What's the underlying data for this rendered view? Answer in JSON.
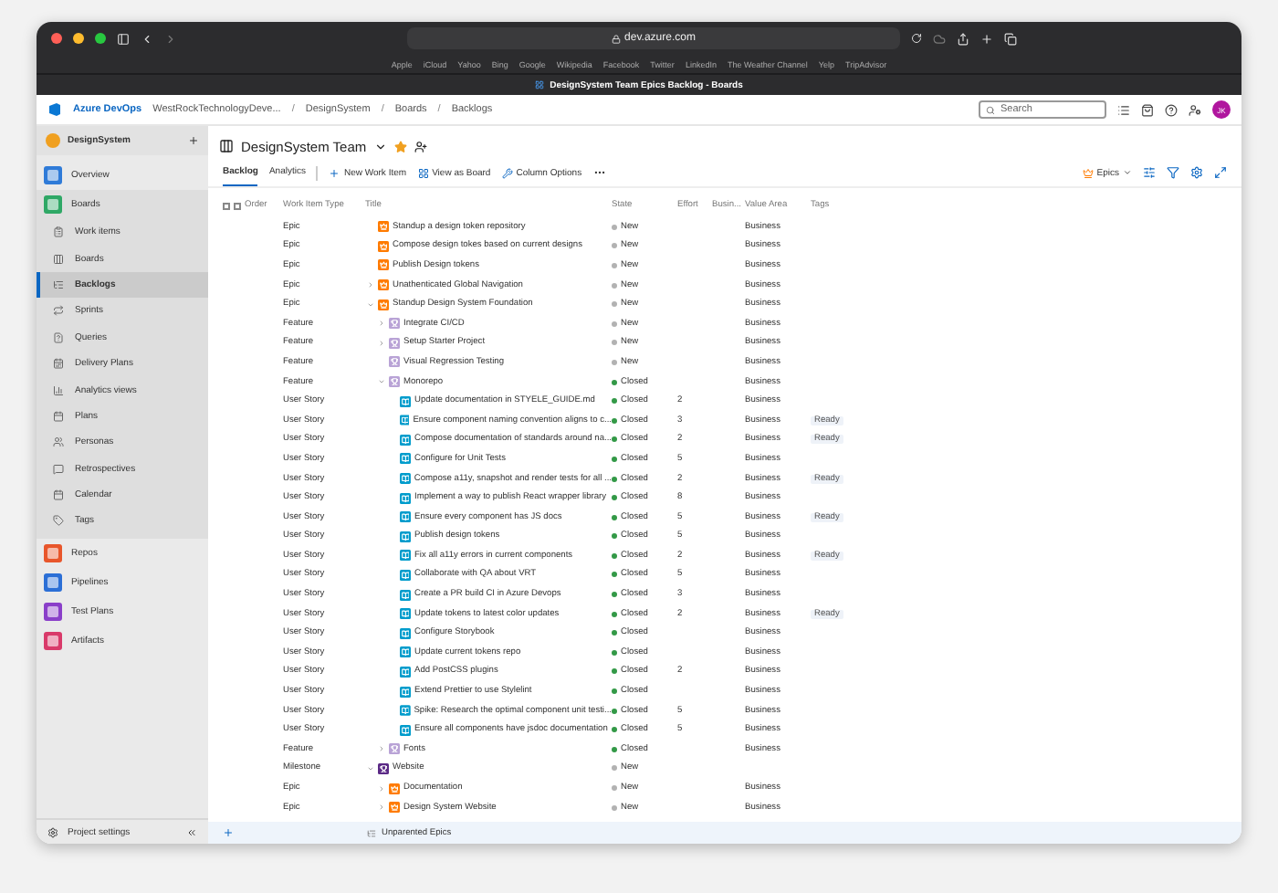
{
  "browser": {
    "address": "dev.azure.com",
    "favorites": [
      "Apple",
      "iCloud",
      "Yahoo",
      "Bing",
      "Google",
      "Wikipedia",
      "Facebook",
      "Twitter",
      "LinkedIn",
      "The Weather Channel",
      "Yelp",
      "TripAdvisor"
    ],
    "tab_title": "DesignSystem Team Epics Backlog - Boards"
  },
  "header": {
    "product": "Azure DevOps",
    "breadcrumbs": [
      {
        "label": "WestRockTechnologyDeve..."
      },
      {
        "separator": "/",
        "label": "DesignSystem"
      },
      {
        "separator": "/",
        "label": "Boards"
      },
      {
        "separator": "/",
        "label": "Backlogs"
      }
    ],
    "search": {
      "placeholder": "Search"
    },
    "avatar": "JK"
  },
  "sidebar": {
    "project": "DesignSystem",
    "items": [
      {
        "label": "Overview",
        "color": "#2f7bd8",
        "expanded": false,
        "selected": false
      },
      {
        "label": "Boards",
        "color": "#2fa866",
        "expanded": true,
        "selected": false,
        "children": [
          {
            "label": "Work items",
            "selected": false
          },
          {
            "label": "Boards",
            "selected": false
          },
          {
            "label": "Backlogs",
            "selected": true
          },
          {
            "label": "Sprints",
            "selected": false
          },
          {
            "label": "Queries",
            "selected": false
          },
          {
            "label": "Delivery Plans",
            "selected": false
          },
          {
            "label": "Analytics views",
            "selected": false
          },
          {
            "label": "Plans",
            "selected": false
          },
          {
            "label": "Personas",
            "selected": false
          },
          {
            "label": "Retrospectives",
            "selected": false
          },
          {
            "label": "Calendar",
            "selected": false
          },
          {
            "label": "Tags",
            "selected": false
          }
        ]
      },
      {
        "label": "Repos",
        "color": "#e8562b",
        "expanded": false,
        "selected": false
      },
      {
        "label": "Pipelines",
        "color": "#2b6fd6",
        "expanded": false,
        "selected": false
      },
      {
        "label": "Test Plans",
        "color": "#8a3fc9",
        "expanded": false,
        "selected": false
      },
      {
        "label": "Artifacts",
        "color": "#d93a6a",
        "expanded": false,
        "selected": false
      }
    ],
    "footer": "Project settings"
  },
  "team": {
    "name": "DesignSystem Team",
    "favorite": true
  },
  "tabs": [
    {
      "label": "Backlog",
      "selected": true
    },
    {
      "label": "Analytics",
      "selected": false
    }
  ],
  "toolbar": [
    "New Work Item",
    "View as Board",
    "Column Options"
  ],
  "level": "Epics",
  "columns": [
    "Order",
    "Work Item Type",
    "Title",
    "State",
    "Effort",
    "Busin...",
    "Value Area",
    "Tags"
  ],
  "rows": [
    {
      "type": "Epic",
      "kind": "epic",
      "title": "Standup a design token repository",
      "state": "New",
      "color": "#b2b2b2",
      "value_area": "Business"
    },
    {
      "type": "Epic",
      "kind": "epic",
      "title": "Compose design tokes based on current designs",
      "state": "New",
      "color": "#b2b2b2",
      "value_area": "Business"
    },
    {
      "type": "Epic",
      "kind": "epic",
      "title": "Publish Design tokens",
      "state": "New",
      "color": "#b2b2b2",
      "value_area": "Business"
    },
    {
      "type": "Epic",
      "kind": "epic",
      "title": "Unathenticated Global Navigation",
      "state": "New",
      "color": "#b2b2b2",
      "value_area": "Business",
      "expanded": false
    },
    {
      "type": "Epic",
      "kind": "epic",
      "title": "Standup Design System Foundation",
      "state": "New",
      "color": "#b2b2b2",
      "value_area": "Business",
      "expanded": true,
      "children": [
        {
          "type": "Feature",
          "kind": "feature",
          "title": "Integrate CI/CD",
          "state": "New",
          "color": "#b2b2b2",
          "value_area": "Business",
          "expanded": false
        },
        {
          "type": "Feature",
          "kind": "feature",
          "title": "Setup Starter Project",
          "state": "New",
          "color": "#b2b2b2",
          "value_area": "Business",
          "expanded": false
        },
        {
          "type": "Feature",
          "kind": "feature",
          "title": "Visual Regression Testing",
          "state": "New",
          "color": "#b2b2b2",
          "value_area": "Business"
        },
        {
          "type": "Feature",
          "kind": "feature",
          "title": "Monorepo",
          "state": "Closed",
          "color": "#339947",
          "value_area": "Business",
          "expanded": true,
          "children": [
            {
              "type": "User Story",
              "kind": "story",
              "title": "Update documentation in STYELE_GUIDE.md",
              "state": "Closed",
              "color": "#339947",
              "effort": "2",
              "value_area": "Business"
            },
            {
              "type": "User Story",
              "kind": "story",
              "title": "Ensure component naming convention aligns to c...",
              "state": "Closed",
              "color": "#339947",
              "effort": "3",
              "value_area": "Business",
              "tag": "Ready"
            },
            {
              "type": "User Story",
              "kind": "story",
              "title": "Compose documentation of standards around na...",
              "state": "Closed",
              "color": "#339947",
              "effort": "2",
              "value_area": "Business",
              "tag": "Ready"
            },
            {
              "type": "User Story",
              "kind": "story",
              "title": "Configure for Unit Tests",
              "state": "Closed",
              "color": "#339947",
              "effort": "5",
              "value_area": "Business"
            },
            {
              "type": "User Story",
              "kind": "story",
              "title": "Compose a11y, snapshot and render tests for all ...",
              "state": "Closed",
              "color": "#339947",
              "effort": "2",
              "value_area": "Business",
              "tag": "Ready"
            },
            {
              "type": "User Story",
              "kind": "story",
              "title": "Implement a way to publish React wrapper library",
              "state": "Closed",
              "color": "#339947",
              "effort": "8",
              "value_area": "Business"
            },
            {
              "type": "User Story",
              "kind": "story",
              "title": "Ensure every component has JS docs",
              "state": "Closed",
              "color": "#339947",
              "effort": "5",
              "value_area": "Business",
              "tag": "Ready"
            },
            {
              "type": "User Story",
              "kind": "story",
              "title": "Publish design tokens",
              "state": "Closed",
              "color": "#339947",
              "effort": "5",
              "value_area": "Business"
            },
            {
              "type": "User Story",
              "kind": "story",
              "title": "Fix all a11y errors in current components",
              "state": "Closed",
              "color": "#339947",
              "effort": "2",
              "value_area": "Business",
              "tag": "Ready"
            },
            {
              "type": "User Story",
              "kind": "story",
              "title": "Collaborate with QA about VRT",
              "state": "Closed",
              "color": "#339947",
              "effort": "5",
              "value_area": "Business"
            },
            {
              "type": "User Story",
              "kind": "story",
              "title": "Create a PR build CI in Azure Devops",
              "state": "Closed",
              "color": "#339947",
              "effort": "3",
              "value_area": "Business"
            },
            {
              "type": "User Story",
              "kind": "story",
              "title": "Update tokens to latest color updates",
              "state": "Closed",
              "color": "#339947",
              "effort": "2",
              "value_area": "Business",
              "tag": "Ready"
            },
            {
              "type": "User Story",
              "kind": "story",
              "title": "Configure Storybook",
              "state": "Closed",
              "color": "#339947",
              "value_area": "Business"
            },
            {
              "type": "User Story",
              "kind": "story",
              "title": "Update current tokens repo",
              "state": "Closed",
              "color": "#339947",
              "value_area": "Business"
            },
            {
              "type": "User Story",
              "kind": "story",
              "title": "Add PostCSS plugins",
              "state": "Closed",
              "color": "#339947",
              "effort": "2",
              "value_area": "Business"
            },
            {
              "type": "User Story",
              "kind": "story",
              "title": "Extend Prettier to use Stylelint",
              "state": "Closed",
              "color": "#339947",
              "value_area": "Business"
            },
            {
              "type": "User Story",
              "kind": "story",
              "title": "Spike: Research the optimal component unit testi...",
              "state": "Closed",
              "color": "#339947",
              "effort": "5",
              "value_area": "Business"
            },
            {
              "type": "User Story",
              "kind": "story",
              "title": "Ensure all components have jsdoc documentation",
              "state": "Closed",
              "color": "#339947",
              "effort": "5",
              "value_area": "Business"
            }
          ]
        },
        {
          "type": "Feature",
          "kind": "feature",
          "title": "Fonts",
          "state": "Closed",
          "color": "#339947",
          "value_area": "Business",
          "expanded": false
        }
      ]
    },
    {
      "type": "Milestone",
      "kind": "milestone",
      "title": "Website",
      "state": "New",
      "color": "#b2b2b2",
      "expanded": true,
      "children": [
        {
          "type": "Epic",
          "kind": "epic",
          "title": "Documentation",
          "state": "New",
          "color": "#b2b2b2",
          "value_area": "Business",
          "expanded": false
        },
        {
          "type": "Epic",
          "kind": "epic",
          "title": "Design System Website",
          "state": "New",
          "color": "#b2b2b2",
          "value_area": "Business",
          "expanded": false
        }
      ]
    }
  ],
  "footer_row": "Unparented Epics"
}
